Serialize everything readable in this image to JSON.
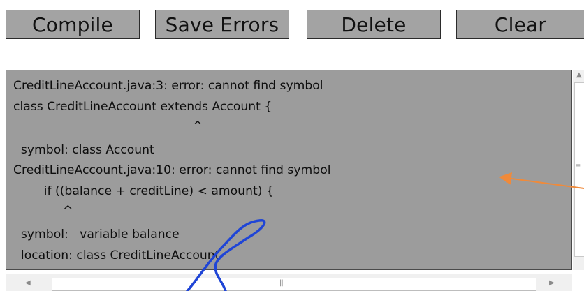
{
  "toolbar": {
    "compile_label": "Compile",
    "save_errors_label": "Save Errors",
    "delete_label": "Delete",
    "clear_label": "Clear"
  },
  "output": {
    "lines": [
      "CreditLineAccount.java:3: error: cannot find symbol",
      "class CreditLineAccount extends Account {",
      "                                               ^",
      "  symbol: class Account",
      "CreditLineAccount.java:10: error: cannot find symbol",
      "        if ((balance + creditLine) < amount) {",
      "             ^",
      "  symbol:   variable balance",
      "  location: class CreditLineAccount"
    ]
  },
  "colors": {
    "button_bg": "#a3a3a3",
    "output_bg": "#9c9c9c",
    "annotation_arrow": "#f08a3a",
    "pen_stroke": "#1f45d6"
  },
  "icons": {
    "scroll_up": "triangle-up",
    "scroll_left": "triangle-left",
    "scroll_right": "triangle-right",
    "grip": "grip-lines"
  }
}
